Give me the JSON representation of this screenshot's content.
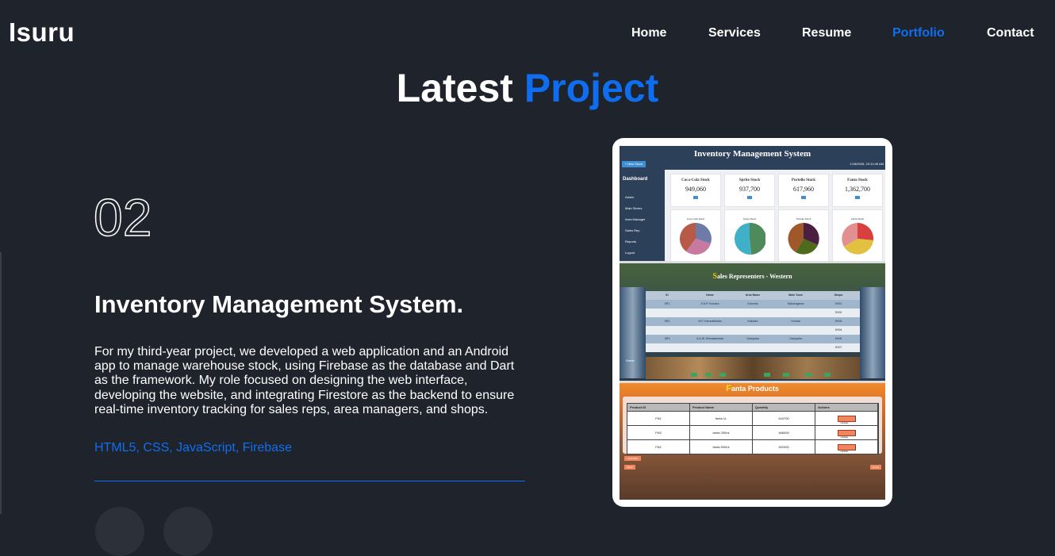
{
  "brand": {
    "name": "Isuru"
  },
  "nav": {
    "items": [
      {
        "label": "Home",
        "active": false
      },
      {
        "label": "Services",
        "active": false
      },
      {
        "label": "Resume",
        "active": false
      },
      {
        "label": "Portfolio",
        "active": true
      },
      {
        "label": "Contact",
        "active": false
      }
    ]
  },
  "heading": {
    "text": "Latest",
    "accent": "Project"
  },
  "project": {
    "number": "02",
    "title": "Inventory Management System.",
    "description": "For my third-year project, we developed a web application and an Android app to manage warehouse stock, using Firebase as the database and Dart as the framework. My role focused on designing the web interface, developing the website, and integrating Firestore as the backend to ensure real-time inventory tracking for sales reps, area managers, and shops.",
    "tech": "HTML5, CSS, JavaScript, Firebase"
  },
  "colors": {
    "background": "#1f232b",
    "accent": "#0f6ef0",
    "text": "#ffffff"
  },
  "screenshot": {
    "dashboard": {
      "title": "Inventory Management System",
      "new_stock": "+ New Stock",
      "date": "1/18/2025, 23:10:45 AM",
      "sidebar_title": "Dashboard",
      "sidebar_items": [
        "Admin",
        "Main Stores",
        "Area Manager",
        "Sales Rep",
        "Reports",
        "Logout"
      ],
      "cards": [
        {
          "label": "Coca-Cola Stock",
          "value": "949,060"
        },
        {
          "label": "Sprite Stock",
          "value": "937,700"
        },
        {
          "label": "Portello Stock",
          "value": "617,960"
        },
        {
          "label": "Fanta Stock",
          "value": "1,362,700"
        }
      ],
      "pie_labels": [
        "Coca Cola Stock",
        "Sprite Stock",
        "Portello Stock",
        "Fanta Stock"
      ]
    },
    "sales_reps": {
      "title_first": "S",
      "title_rest": "ales Representers - Western",
      "columns": [
        "ID",
        "Name",
        "Area Name",
        "Main Town",
        "Shops"
      ],
      "rows": [
        [
          "SR1",
          "S.N.P. Kumara",
          "Colombo",
          "Maharagama",
          "SH01"
        ],
        [
          "",
          "",
          "",
          "",
          "SH02"
        ],
        [
          "SR2",
          "M.P. Karunathilaka",
          "Kalutara",
          "Horana",
          "SH03"
        ],
        [
          "",
          "",
          "",
          "",
          "SH04"
        ],
        [
          "SR3",
          "A.A.W. Wimalasekara",
          "Gampaha",
          "Gampaha",
          "SH05"
        ],
        [
          "",
          "",
          "",
          "",
          "SH07"
        ]
      ],
      "home": "Home"
    },
    "fanta": {
      "title_first": "F",
      "title_rest": "anta Products",
      "columns": [
        "Product ID",
        "Product Name",
        "Quantity",
        "Actions"
      ],
      "rows": [
        [
          "FN1",
          "fanta 1L",
          "444700",
          "Update"
        ],
        [
          "FN3",
          "fanta 250ml",
          "466000",
          "Update"
        ],
        [
          "FN2",
          "fanta 500ml",
          "452000",
          "Update"
        ]
      ],
      "add_new": "Add New",
      "back": "Back",
      "home": "Home"
    }
  }
}
